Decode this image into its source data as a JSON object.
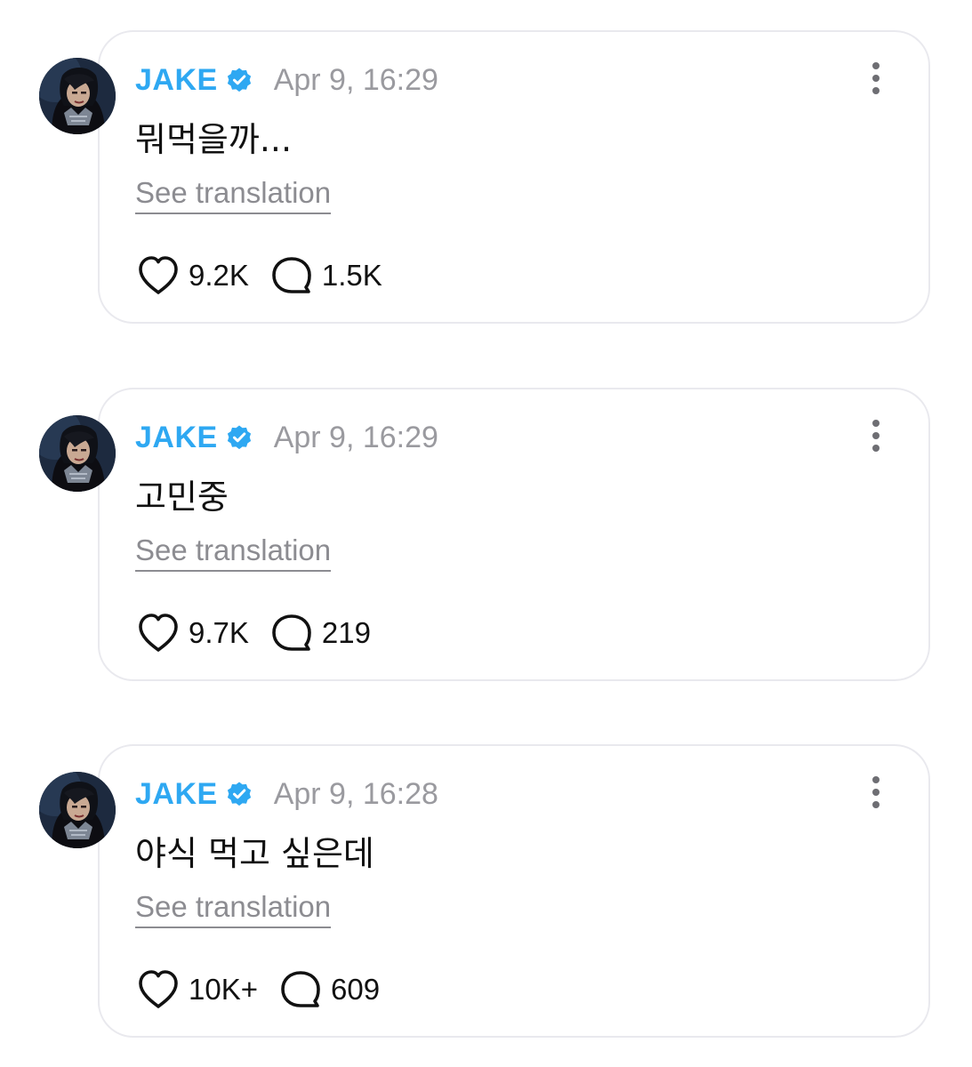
{
  "colors": {
    "author": "#2ea8f2",
    "verified_badge": "#2ea8f2",
    "timestamp": "#9a9a9f",
    "card_border": "#e9e9ee"
  },
  "icons": {
    "verified": "verified-badge-icon",
    "more": "more-vertical-icon",
    "like": "heart-icon",
    "comment": "speech-bubble-icon"
  },
  "posts": [
    {
      "author": "JAKE",
      "timestamp": "Apr 9, 16:29",
      "text": "뭐먹을까...",
      "translate_label": "See translation",
      "likes": "9.2K",
      "comments": "1.5K"
    },
    {
      "author": "JAKE",
      "timestamp": "Apr 9, 16:29",
      "text": "고민중",
      "translate_label": "See translation",
      "likes": "9.7K",
      "comments": "219"
    },
    {
      "author": "JAKE",
      "timestamp": "Apr 9, 16:28",
      "text": "야식 먹고 싶은데",
      "translate_label": "See translation",
      "likes": "10K+",
      "comments": "609"
    }
  ]
}
